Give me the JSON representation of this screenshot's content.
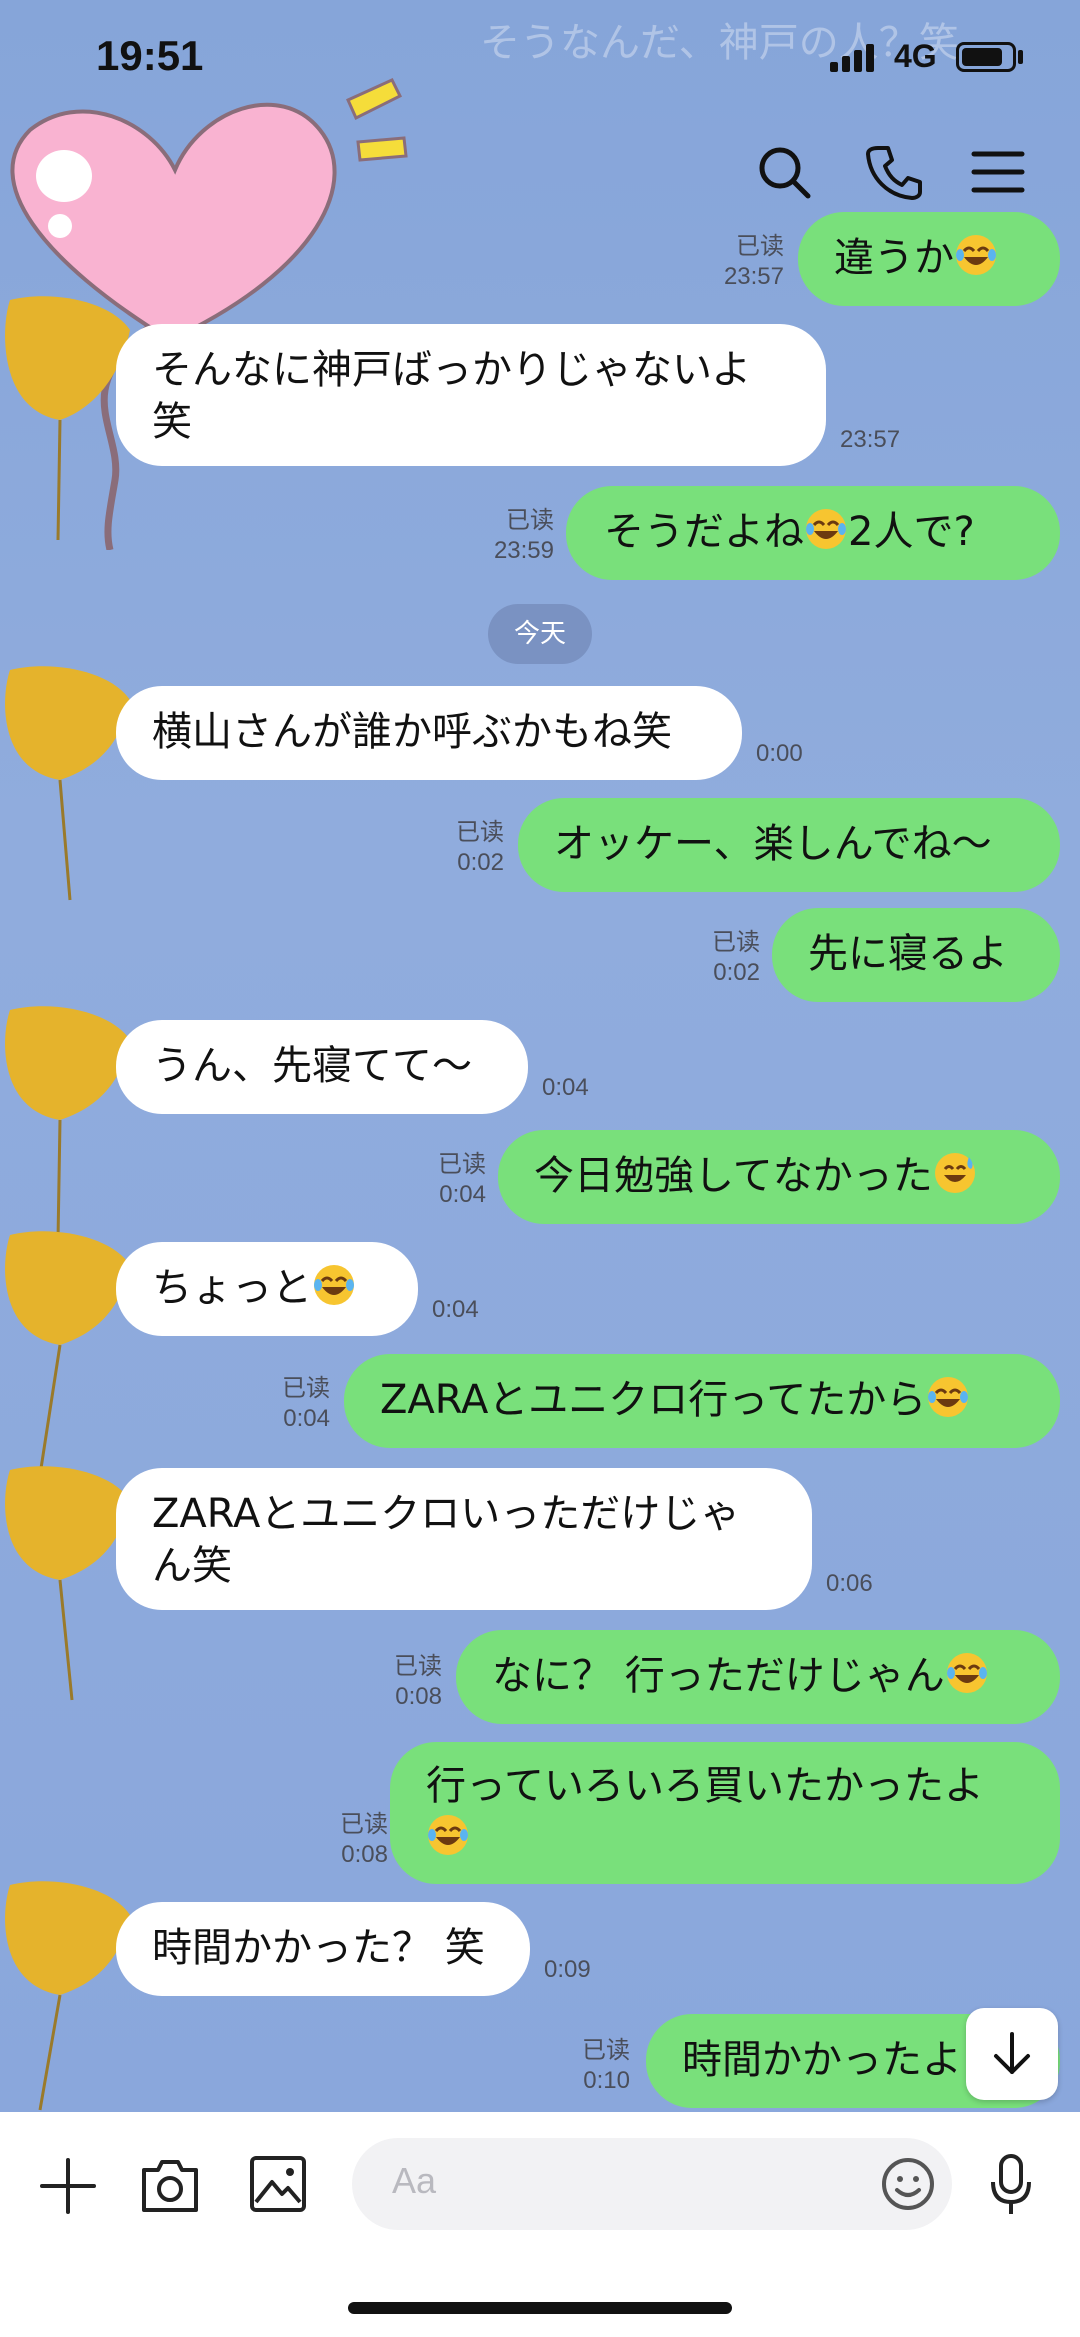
{
  "status_bar": {
    "time": "19:51",
    "network": "4G"
  },
  "ghost_banner": "そうなんだ、神戸の人？笑",
  "date_separator": "今天",
  "messages": [
    {
      "side": "right",
      "text": "違うか",
      "read": "已读",
      "time": "23:57",
      "emoji": "laugh"
    },
    {
      "side": "left",
      "line1": "そんなに神戸ばっかりじゃないよ",
      "line2": "笑",
      "time": "23:57"
    },
    {
      "side": "right",
      "text": "そうだよね",
      "text2": "2人で?",
      "read": "已读",
      "time": "23:59",
      "emoji": "laugh"
    },
    {
      "side": "left",
      "text": "横山さんが誰か呼ぶかもね笑",
      "time": "0:00"
    },
    {
      "side": "right",
      "text": "オッケー、楽しんでね～",
      "read": "已读",
      "time": "0:02"
    },
    {
      "side": "right",
      "text": "先に寝るよ",
      "read": "已读",
      "time": "0:02"
    },
    {
      "side": "left",
      "text": "うん、先寝てて～",
      "time": "0:04"
    },
    {
      "side": "right",
      "text": "今日勉強してなかった",
      "read": "已读",
      "time": "0:04",
      "emoji": "sweat"
    },
    {
      "side": "left",
      "text": "ちょっと",
      "time": "0:04",
      "emoji": "laugh"
    },
    {
      "side": "right",
      "text": "ZARAとユニクロ行ってたから",
      "read": "已读",
      "time": "0:04",
      "emoji": "laugh"
    },
    {
      "side": "left",
      "line1": "ZARAとユニクロいっただけじゃ",
      "line2": "ん笑",
      "time": "0:06"
    },
    {
      "side": "right",
      "text": "なに？ 行っただけじゃん",
      "read": "已读",
      "time": "0:08",
      "emoji": "laugh"
    },
    {
      "side": "right",
      "line1": "行っていろいろ買いたかったよ",
      "read": "已读",
      "time": "0:08",
      "emoji": "laugh"
    },
    {
      "side": "left",
      "text": "時間かかった？ 笑",
      "time": "0:09"
    },
    {
      "side": "right",
      "text": "時間かかったよ",
      "read": "已读",
      "time": "0:10"
    }
  ],
  "input": {
    "placeholder": "Aa"
  },
  "icons": [
    "search-icon",
    "phone-icon",
    "menu-icon",
    "plus-icon",
    "camera-icon",
    "image-icon",
    "emoji-icon",
    "mic-icon",
    "arrow-down-icon"
  ],
  "colors": {
    "background": "#8aa7dc",
    "sent_bubble": "#79e07b",
    "received_bubble": "#ffffff"
  }
}
